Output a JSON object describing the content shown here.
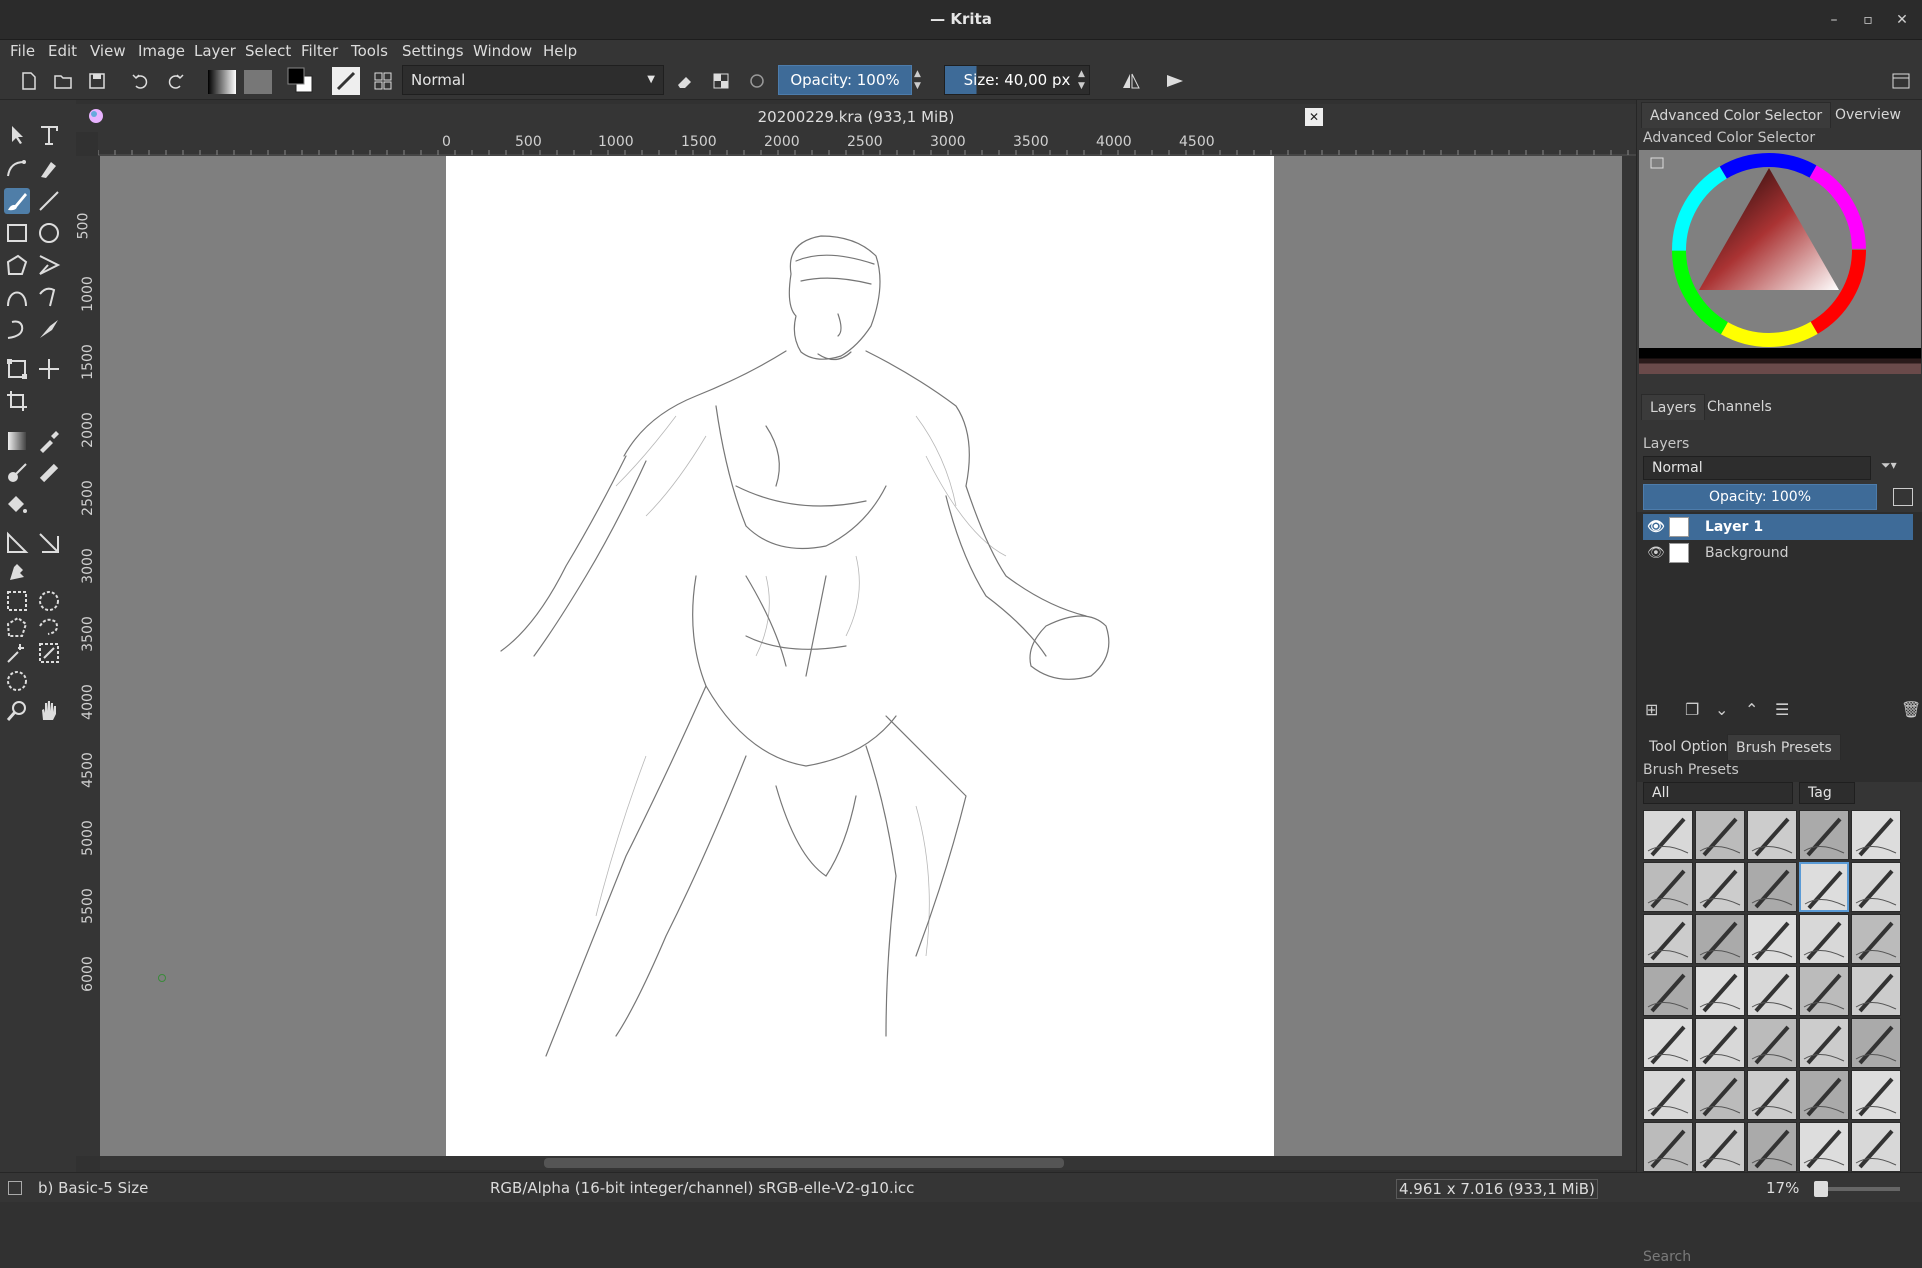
{
  "window": {
    "title": "— Krita"
  },
  "menu": [
    "File",
    "Edit",
    "View",
    "Image",
    "Layer",
    "Select",
    "Filter",
    "Tools",
    "Settings",
    "Window",
    "Help"
  ],
  "toolbar": {
    "blend_mode": "Normal",
    "opacity_label": "Opacity: 100%",
    "size_label": "Size: 40,00 px"
  },
  "document": {
    "tab_title": "20200229.kra (933,1 MiB)",
    "h_ruler_ticks": [
      "0",
      "500",
      "1000",
      "1500",
      "2000",
      "2500",
      "3000",
      "3500",
      "4000",
      "4500"
    ],
    "v_ruler_ticks": [
      "500",
      "1000",
      "1500",
      "2000",
      "2500",
      "3000",
      "3500",
      "4000",
      "4500",
      "5000",
      "5500",
      "6000"
    ]
  },
  "docker": {
    "top_tabs": [
      "Advanced Color Selector",
      "Overview"
    ],
    "color_selector_title": "Advanced Color Selector",
    "layer_tabs": [
      "Layers",
      "Channels"
    ],
    "layers_title": "Layers",
    "layers_blend": "Normal",
    "layers_opacity": "Opacity:  100%",
    "layers": [
      {
        "name": "Layer 1",
        "selected": true
      },
      {
        "name": "Background",
        "selected": false
      }
    ],
    "bottom_tabs": [
      "Tool Options",
      "Brush Presets"
    ],
    "brush_presets_title": "Brush Presets",
    "brush_filter": "All",
    "tag_label": "Tag",
    "search_placeholder": "Search"
  },
  "status": {
    "brush": "b) Basic-5 Size",
    "color_space": "RGB/Alpha (16-bit integer/channel)  sRGB-elle-V2-g10.icc",
    "dimensions": "4.961 x 7.016 (933,1 MiB)",
    "zoom": "17%"
  },
  "colors": {
    "accent": "#3e6b98",
    "panel": "#353535",
    "canvas_bg": "#7f7f7f"
  }
}
